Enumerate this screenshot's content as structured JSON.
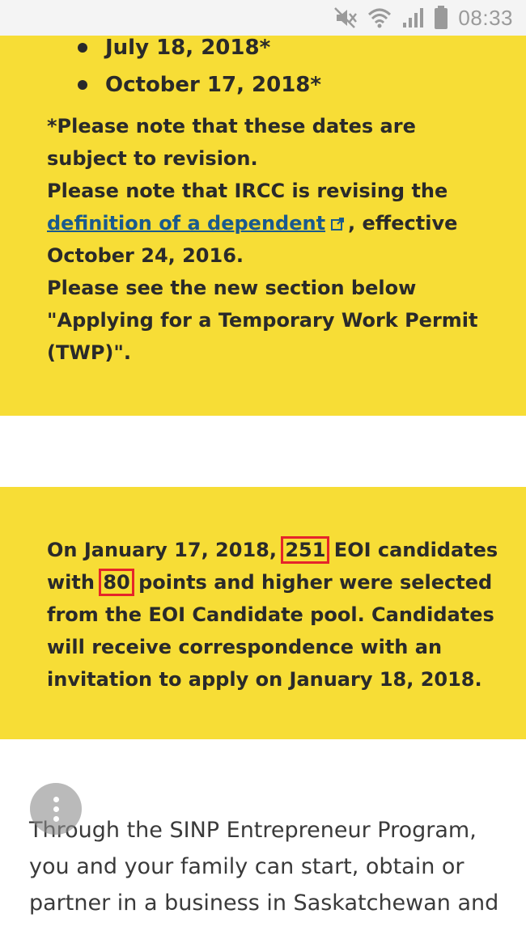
{
  "status_bar": {
    "time": "08:33",
    "icons": [
      "mute-icon",
      "wifi-icon",
      "signal-icon",
      "battery-icon"
    ]
  },
  "notice_box": {
    "dates": [
      "July 18, 2018*",
      "October 17, 2018*"
    ],
    "note_line1": "*Please note that these dates are subject to revision.",
    "note_line2_before": "Please note that IRCC is revising the ",
    "link_text": "definition of a dependent",
    "note_line2_after": ", effective October 24, 2016.",
    "note_line3": "Please see the new section below \"Applying for a Temporary Work Permit (TWP)\"."
  },
  "eoi_box": {
    "text_part1": "On January 17, 2018,",
    "highlight_count": "251",
    "text_part2": "EOI candidates with",
    "highlight_points": "80",
    "text_part3": "points and higher were selected from the EOI Candidate pool.  Candidates will receive correspondence with an invitation to apply on January 18, 2018."
  },
  "body": {
    "paragraph": "Through the SINP Entrepreneur Program, you and your family can start, obtain or partner in a business in Saskatchewan and"
  },
  "colors": {
    "notice_background": "#f7dd36",
    "link": "#1a5a8e",
    "highlight_border": "#e5252a"
  }
}
